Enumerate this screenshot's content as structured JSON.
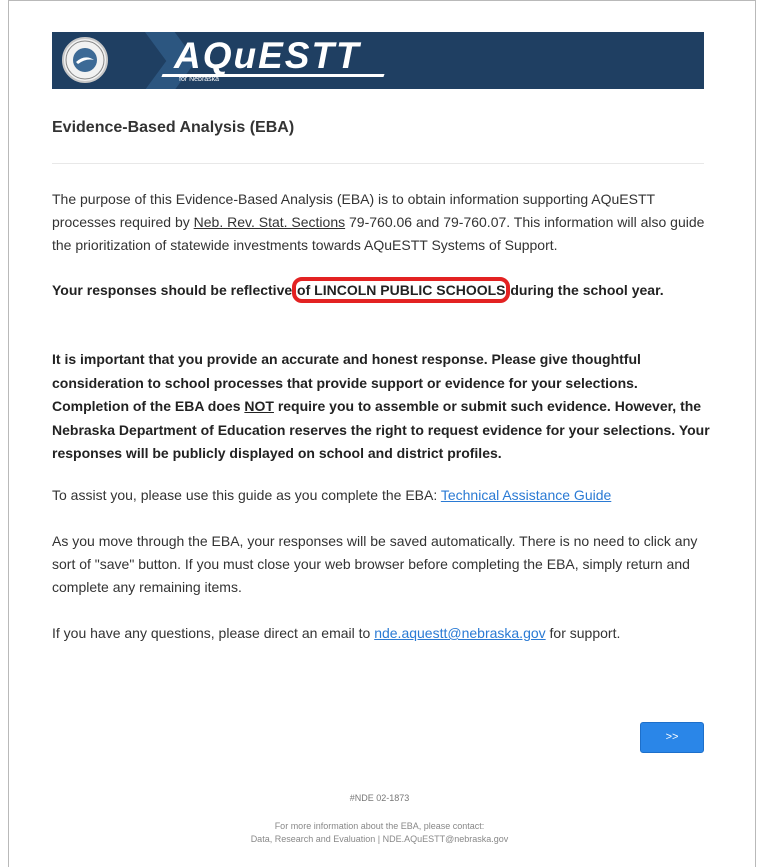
{
  "header": {
    "seal_text": "NEBRASKA DEPARTMENT OF EDUCATION",
    "logo": "AQuESTT",
    "logo_sub": "for Nebraska"
  },
  "page_title": "Evidence-Based Analysis (EBA)",
  "intro": {
    "text1": "The purpose of this Evidence-Based Analysis (EBA) is to obtain information supporting AQuESTT processes required by ",
    "link_text": "Neb. Rev. Stat. Sections",
    "text2": " 79-760.06 and 79-760.07. This information will also guide the prioritization of statewide investments towards AQuESTT Systems of Support."
  },
  "reflective": {
    "before": "Your responses should be reflective ",
    "highlight": "of LINCOLN PUBLIC SCHOOLS",
    "after": " during the school year."
  },
  "important": {
    "text1": "It is important that you provide an accurate and honest response. Please give thoughtful consideration to school processes that provide support or evidence for your selections. Completion of the EBA does ",
    "not": "NOT",
    "text2": " require you to assemble or submit such evidence. However, the Nebraska Department of Education reserves the right to request evidence for your selections. Your responses will be publicly displayed on school and district profiles."
  },
  "guide": {
    "text": "To assist you, please use this guide as you complete the EBA: ",
    "link": "Technical Assistance Guide"
  },
  "autosave": "As you move through the EBA, your responses will be saved automatically. There is no need to click any sort of \"save\" button. If you must close your web browser before completing the EBA, simply return and complete any remaining items.",
  "questions": {
    "text1": "If you have any questions, please direct an email to ",
    "email": "nde.aquestt@nebraska.gov",
    "text2": " for support."
  },
  "next_button": ">>",
  "footer": {
    "code": "#NDE 02-1873",
    "line1": "For more information about the EBA, please contact:",
    "line2": "Data, Research and Evaluation | NDE.AQuESTT@nebraska.gov"
  },
  "colors": {
    "banner": "#1f3f62",
    "link": "#2a7ad4",
    "button": "#2a86e8",
    "highlight_ring": "#e32222"
  }
}
